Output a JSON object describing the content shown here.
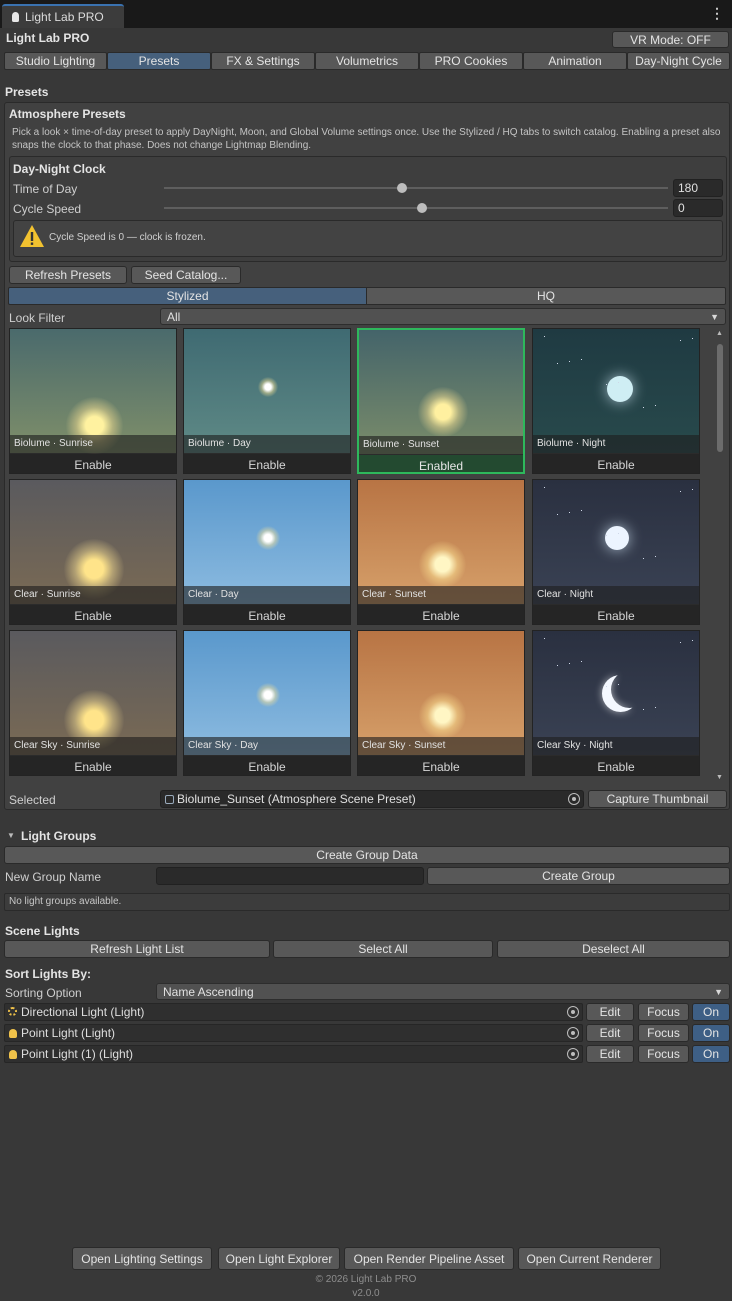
{
  "window": {
    "tab_title": "Light Lab PRO",
    "tab_icon": "bulb-icon",
    "menu_icon": "kebab-menu-icon"
  },
  "header": {
    "title": "Light Lab PRO",
    "vr_mode_label": "VR Mode: OFF"
  },
  "main_tabs": [
    {
      "label": "Studio Lighting",
      "selected": false
    },
    {
      "label": "Presets",
      "selected": true
    },
    {
      "label": "FX & Settings",
      "selected": false
    },
    {
      "label": "Volumetrics",
      "selected": false
    },
    {
      "label": "PRO Cookies",
      "selected": false
    },
    {
      "label": "Animation",
      "selected": false
    },
    {
      "label": "Day-Night Cycle",
      "selected": false
    }
  ],
  "presets": {
    "section_title": "Presets",
    "atmosphere": {
      "title": "Atmosphere Presets",
      "description": "Pick a look × time-of-day preset to apply DayNight, Moon, and Global Volume settings once. Use the Stylized / HQ tabs to switch catalog. Enabling a preset also snaps the clock to that phase. Does not change Lightmap Blending."
    },
    "clock": {
      "title": "Day-Night Clock",
      "time_of_day_label": "Time of Day",
      "time_of_day_value": "180",
      "time_of_day_fraction": 0.5,
      "cycle_speed_label": "Cycle Speed",
      "cycle_speed_value": "0",
      "cycle_speed_fraction": 0.5,
      "warning_icon": "warning-triangle-icon",
      "warning_text": "Cycle Speed is 0 — clock is frozen."
    },
    "refresh_label": "Refresh Presets",
    "seed_label": "Seed Catalog...",
    "catalog_tabs": [
      {
        "label": "Stylized",
        "selected": true
      },
      {
        "label": "HQ",
        "selected": false
      }
    ],
    "look_filter_label": "Look Filter",
    "look_filter_value": "All",
    "cards": [
      {
        "caption": "Biolume · Sunrise",
        "button": "Enable",
        "active": false,
        "sky_top": "#4a6a6c",
        "sky_bottom": "#7f8f6a",
        "sun": "#fff2a0",
        "sun_x": 0.5,
        "sun_y": 0.78,
        "sun_size": 0.34,
        "kind": "sun"
      },
      {
        "caption": "Biolume · Day",
        "button": "Enable",
        "active": false,
        "sky_top": "#3f6a72",
        "sky_bottom": "#5f8a86",
        "sun": "#ffffff",
        "sun_x": 0.5,
        "sun_y": 0.47,
        "sun_size": 0.12,
        "kind": "sun"
      },
      {
        "caption": "Biolume · Sunset",
        "button": "Enabled",
        "active": true,
        "sky_top": "#44646a",
        "sky_bottom": "#7a8c6a",
        "sun": "#fff0a0",
        "sun_x": 0.5,
        "sun_y": 0.66,
        "sun_size": 0.3,
        "kind": "sun"
      },
      {
        "caption": "Biolume · Night",
        "button": "Enable",
        "active": false,
        "sky_top": "#1f3a42",
        "sky_bottom": "#284a4c",
        "sun": "#cfeef4",
        "sun_x": 0.52,
        "sun_y": 0.48,
        "sun_size": 0.22,
        "kind": "moon"
      },
      {
        "caption": "Clear · Sunrise",
        "button": "Enable",
        "active": false,
        "sky_top": "#5a5a5e",
        "sky_bottom": "#7a6a54",
        "sun": "#ffe48a",
        "sun_x": 0.5,
        "sun_y": 0.72,
        "sun_size": 0.36,
        "kind": "sun"
      },
      {
        "caption": "Clear · Day",
        "button": "Enable",
        "active": false,
        "sky_top": "#5a98cc",
        "sky_bottom": "#8cbbe0",
        "sun": "#ffffff",
        "sun_x": 0.5,
        "sun_y": 0.47,
        "sun_size": 0.14,
        "kind": "sun"
      },
      {
        "caption": "Clear · Sunset",
        "button": "Enable",
        "active": false,
        "sky_top": "#b87444",
        "sky_bottom": "#d6a06a",
        "sun": "#fff6c4",
        "sun_x": 0.5,
        "sun_y": 0.68,
        "sun_size": 0.28,
        "kind": "sun"
      },
      {
        "caption": "Clear · Night",
        "button": "Enable",
        "active": false,
        "sky_top": "#2a3040",
        "sky_bottom": "#3a4254",
        "sun": "#ecf4ff",
        "sun_x": 0.5,
        "sun_y": 0.47,
        "sun_size": 0.2,
        "kind": "moon"
      },
      {
        "caption": "Clear Sky · Sunrise",
        "button": "Enable",
        "active": false,
        "sky_top": "#5a5a5e",
        "sky_bottom": "#7a6a54",
        "sun": "#ffe48a",
        "sun_x": 0.5,
        "sun_y": 0.72,
        "sun_size": 0.36,
        "kind": "sun"
      },
      {
        "caption": "Clear Sky · Day",
        "button": "Enable",
        "active": false,
        "sky_top": "#5a98cc",
        "sky_bottom": "#8cbbe0",
        "sun": "#ffffff",
        "sun_x": 0.5,
        "sun_y": 0.52,
        "sun_size": 0.14,
        "kind": "sun"
      },
      {
        "caption": "Clear Sky · Sunset",
        "button": "Enable",
        "active": false,
        "sky_top": "#b87444",
        "sky_bottom": "#d6a06a",
        "sun": "#fff6c4",
        "sun_x": 0.5,
        "sun_y": 0.68,
        "sun_size": 0.28,
        "kind": "sun"
      },
      {
        "caption": "Clear Sky · Night",
        "button": "Enable",
        "active": false,
        "sky_top": "#2a3040",
        "sky_bottom": "#3a4254",
        "sun": "#f4f8ff",
        "sun_x": 0.52,
        "sun_y": 0.5,
        "sun_size": 0.26,
        "kind": "crescent"
      }
    ],
    "selected_label": "Selected",
    "selected_value": "Biolume_Sunset (Atmosphere Scene Preset)",
    "capture_label": "Capture Thumbnail"
  },
  "light_groups": {
    "title": "Light Groups",
    "create_data_label": "Create Group Data",
    "new_group_label": "New Group Name",
    "new_group_value": "",
    "create_group_label": "Create Group",
    "empty_text": "No light groups available."
  },
  "scene_lights": {
    "title": "Scene Lights",
    "refresh_label": "Refresh Light List",
    "select_all_label": "Select All",
    "deselect_all_label": "Deselect All",
    "sort_title": "Sort Lights By:",
    "sorting_label": "Sorting Option",
    "sorting_value": "Name Ascending",
    "lights": [
      {
        "name": "Directional Light (Light)",
        "icon": "directional-light-icon",
        "edit": "Edit",
        "focus": "Focus",
        "toggle": "On"
      },
      {
        "name": "Point Light (Light)",
        "icon": "point-light-icon",
        "edit": "Edit",
        "focus": "Focus",
        "toggle": "On"
      },
      {
        "name": "Point Light (1) (Light)",
        "icon": "point-light-icon",
        "edit": "Edit",
        "focus": "Focus",
        "toggle": "On"
      }
    ]
  },
  "footer_buttons": [
    {
      "label": "Open Lighting Settings"
    },
    {
      "label": "Open Light Explorer"
    },
    {
      "label": "Open Render Pipeline Asset"
    },
    {
      "label": "Open Current Renderer"
    }
  ],
  "footer": {
    "copyright": "© 2026 Light Lab PRO",
    "version": "v2.0.0"
  },
  "colors": {
    "accent": "#46607c",
    "active_border": "#2eb85c",
    "background": "#383838"
  }
}
